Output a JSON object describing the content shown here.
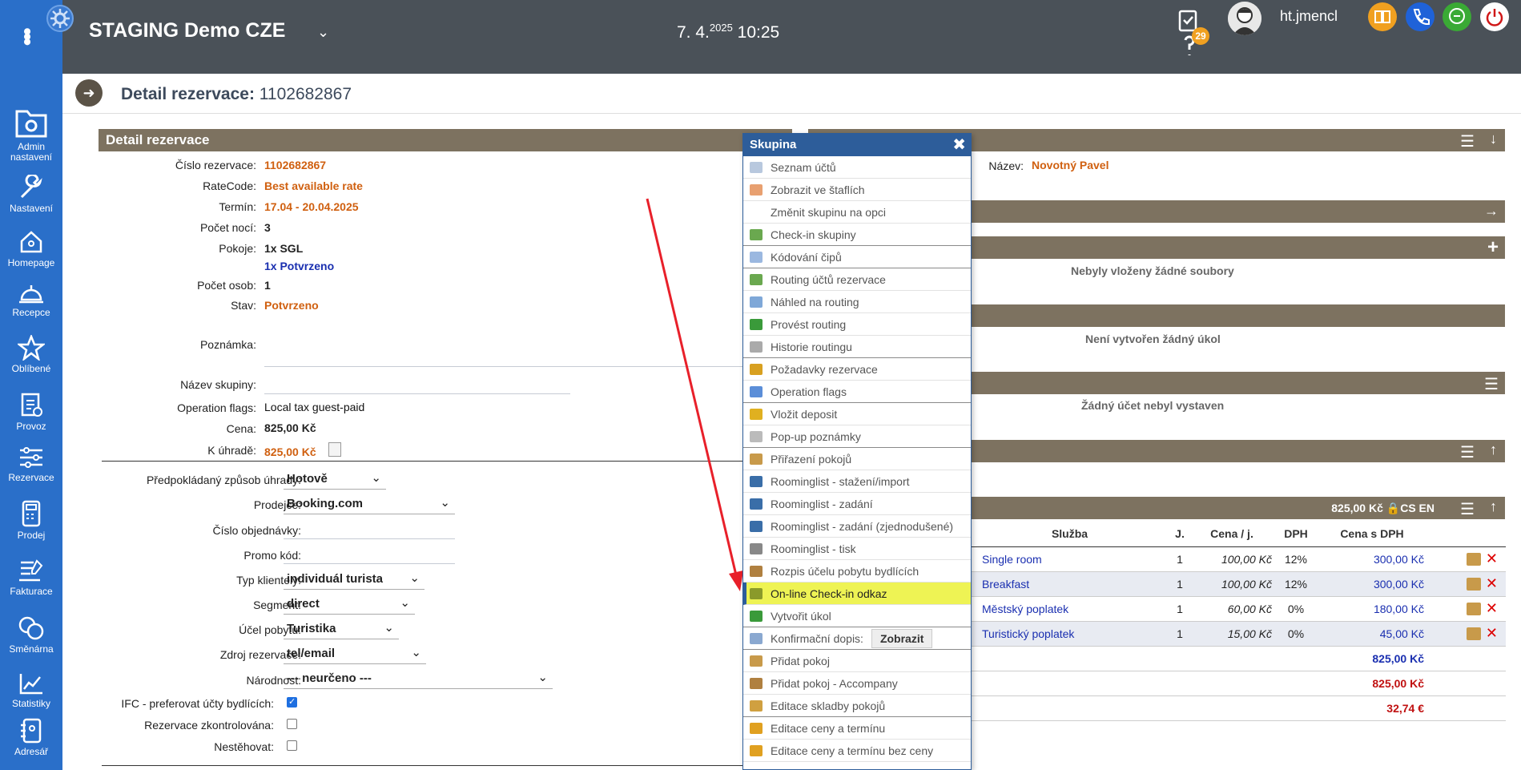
{
  "app": {
    "title": "STAGING Demo CZE",
    "date_main": "7. 4.",
    "date_year": "2025",
    "time": "10:25",
    "task_count": "29",
    "user": "ht.jmencl"
  },
  "sidebar": {
    "items": [
      {
        "id": "admin",
        "label": "Admin nastavení",
        "icon": "folder-gear-icon"
      },
      {
        "id": "nastaveni",
        "label": "Nastavení",
        "icon": "wrench-icon"
      },
      {
        "id": "homepage",
        "label": "Homepage",
        "icon": "home-icon"
      },
      {
        "id": "recepce",
        "label": "Recepce",
        "icon": "bell-icon"
      },
      {
        "id": "oblibene",
        "label": "Oblíbené",
        "icon": "star-icon"
      },
      {
        "id": "provoz",
        "label": "Provoz",
        "icon": "clipboard-icon"
      },
      {
        "id": "rezervace",
        "label": "Rezervace",
        "icon": "sliders-icon"
      },
      {
        "id": "prodej",
        "label": "Prodej",
        "icon": "register-icon"
      },
      {
        "id": "fakturace",
        "label": "Fakturace",
        "icon": "invoice-icon"
      },
      {
        "id": "smenarna",
        "label": "Směnárna",
        "icon": "exchange-icon"
      },
      {
        "id": "statistiky",
        "label": "Statistiky",
        "icon": "chart-icon"
      },
      {
        "id": "adresar",
        "label": "Adresář",
        "icon": "contacts-icon"
      }
    ]
  },
  "page": {
    "title_label": "Detail rezervace:",
    "title_id": "1102682867"
  },
  "detail": {
    "panel_title": "Detail rezervace",
    "fields": {
      "cislo_label": "Číslo rezervace:",
      "cislo": "1102682867",
      "ratecode_label": "RateCode:",
      "ratecode": "Best available rate",
      "termin_label": "Termín:",
      "termin": "17.04 - 20.04.2025",
      "noci_label": "Počet nocí:",
      "noci": "3",
      "pokoje_label": "Pokoje:",
      "pokoje": "1x SGL",
      "pokoje_status": "1x Potvrzeno",
      "osob_label": "Počet osob:",
      "osob": "1",
      "stav_label": "Stav:",
      "stav": "Potvrzeno",
      "poznamka_label": "Poznámka:",
      "skupina_label": "Název skupiny:",
      "flags_label": "Operation flags:",
      "flags": "Local tax guest-paid",
      "cena_label": "Cena:",
      "cena": "825,00 Kč",
      "uhrada_label": "K úhradě:",
      "uhrada": "825,00 Kč"
    },
    "form": {
      "platba_label": "Předpokládaný způsob úhrady:",
      "platba": "Hotově",
      "prodejce_label": "Prodejce:",
      "prodejce": "Booking.com",
      "objednavka_label": "Číslo objednávky:",
      "promo_label": "Promo kód:",
      "klient_label": "Typ klientely:",
      "klient": "individuál turista",
      "segment_label": "Segment:",
      "segment": "direct",
      "ucel_label": "Účel pobytu:",
      "ucel": "Turistika",
      "zdroj_label": "Zdroj rezervace:",
      "zdroj": "tel/email",
      "narodnost_label": "Národnost:",
      "narodnost": "--- neurčeno ---",
      "ifc_label": "IFC - preferovat účty bydlících:",
      "zkontrolovana_label": "Rezervace zkontrolována:",
      "nestehovat_label": "Nestěhovat:"
    }
  },
  "menu": {
    "title": "Skupina",
    "items": [
      {
        "label": "Seznam účtů",
        "icon": "search-doc-icon",
        "sep": false
      },
      {
        "label": "Zobrazit ve štaflích",
        "icon": "chart-doc-icon",
        "sep": false
      },
      {
        "label": "Změnit skupinu na opci",
        "icon": "",
        "sep": false
      },
      {
        "label": "Check-in skupiny",
        "icon": "checkin-icon",
        "sep": true
      },
      {
        "label": "Kódování čipů",
        "icon": "tag-icon",
        "sep": true
      },
      {
        "label": "Routing účtů rezervace",
        "icon": "routing-icon",
        "sep": false
      },
      {
        "label": "Náhled na routing",
        "icon": "preview-icon",
        "sep": false
      },
      {
        "label": "Provést routing",
        "icon": "check-icon",
        "sep": false
      },
      {
        "label": "Historie routingu",
        "icon": "history-icon",
        "sep": true
      },
      {
        "label": "Požadavky rezervace",
        "icon": "broom-icon",
        "sep": false
      },
      {
        "label": "Operation flags",
        "icon": "flag-icon",
        "sep": true
      },
      {
        "label": "Vložit deposit",
        "icon": "coins-icon",
        "sep": false
      },
      {
        "label": "Pop-up poznámky",
        "icon": "note-icon",
        "sep": true
      },
      {
        "label": "Přiřazení pokojů",
        "icon": "door-icon",
        "sep": false
      },
      {
        "label": "Roominglist - stažení/import",
        "icon": "book-icon",
        "sep": false
      },
      {
        "label": "Roominglist - zadání",
        "icon": "book-icon",
        "sep": false
      },
      {
        "label": "Roominglist - zadání (zjednodušené)",
        "icon": "book-icon",
        "sep": false
      },
      {
        "label": "Roominglist - tisk",
        "icon": "printer-icon",
        "sep": false
      },
      {
        "label": "Rozpis účelu pobytu bydlících",
        "icon": "users-icon",
        "sep": false
      },
      {
        "label": "On-line Check-in odkaz",
        "icon": "link-icon",
        "sep": false,
        "highlight": true
      },
      {
        "label": "Vytvořit úkol",
        "icon": "task-check-icon",
        "sep": true
      },
      {
        "label": "Konfirmační dopis:",
        "icon": "mail-icon",
        "sep": true,
        "button": "Zobrazit"
      },
      {
        "label": "Přidat pokoj",
        "icon": "door-icon",
        "sep": false
      },
      {
        "label": "Přidat pokoj - Accompany",
        "icon": "users-icon",
        "sep": false
      },
      {
        "label": "Editace skladby pokojů",
        "icon": "edit-icon",
        "sep": true
      },
      {
        "label": "Editace ceny a termínu",
        "icon": "pencil-icon",
        "sep": false
      },
      {
        "label": "Editace ceny a termínu bez ceny",
        "icon": "pencil-icon",
        "sep": false
      }
    ]
  },
  "right": {
    "nazev_label": "Název:",
    "nazev": "Novotný Pavel",
    "soubory_empty": "Nebyly vloženy žádné soubory",
    "ukol_empty": "Není vytvořen žádný úkol",
    "ucet_empty": "Žádný účet nebyl vystaven",
    "summary_total": "825,00 Kč",
    "lang": "CS EN",
    "table": {
      "headers": [
        "Služba",
        "J.",
        "Cena / j.",
        "DPH",
        "Cena s DPH"
      ],
      "rows": [
        [
          "Single room",
          "1",
          "100,00 Kč",
          "12%",
          "300,00 Kč"
        ],
        [
          "Breakfast",
          "1",
          "100,00 Kč",
          "12%",
          "300,00 Kč"
        ],
        [
          "Městský poplatek",
          "1",
          "60,00 Kč",
          "0%",
          "180,00 Kč"
        ],
        [
          "Turistický poplatek",
          "1",
          "15,00 Kč",
          "0%",
          "45,00 Kč"
        ]
      ],
      "total_blue": "825,00 Kč",
      "total_red": "825,00 Kč",
      "total_eur": "32,74 €"
    }
  },
  "colors": {
    "sidebar": "#2a6fc9",
    "topbar": "#4a5158",
    "panel": "#7d7260",
    "accent_orange": "#d06010",
    "highlight": "#eef354",
    "arrow": "#e8202a"
  }
}
